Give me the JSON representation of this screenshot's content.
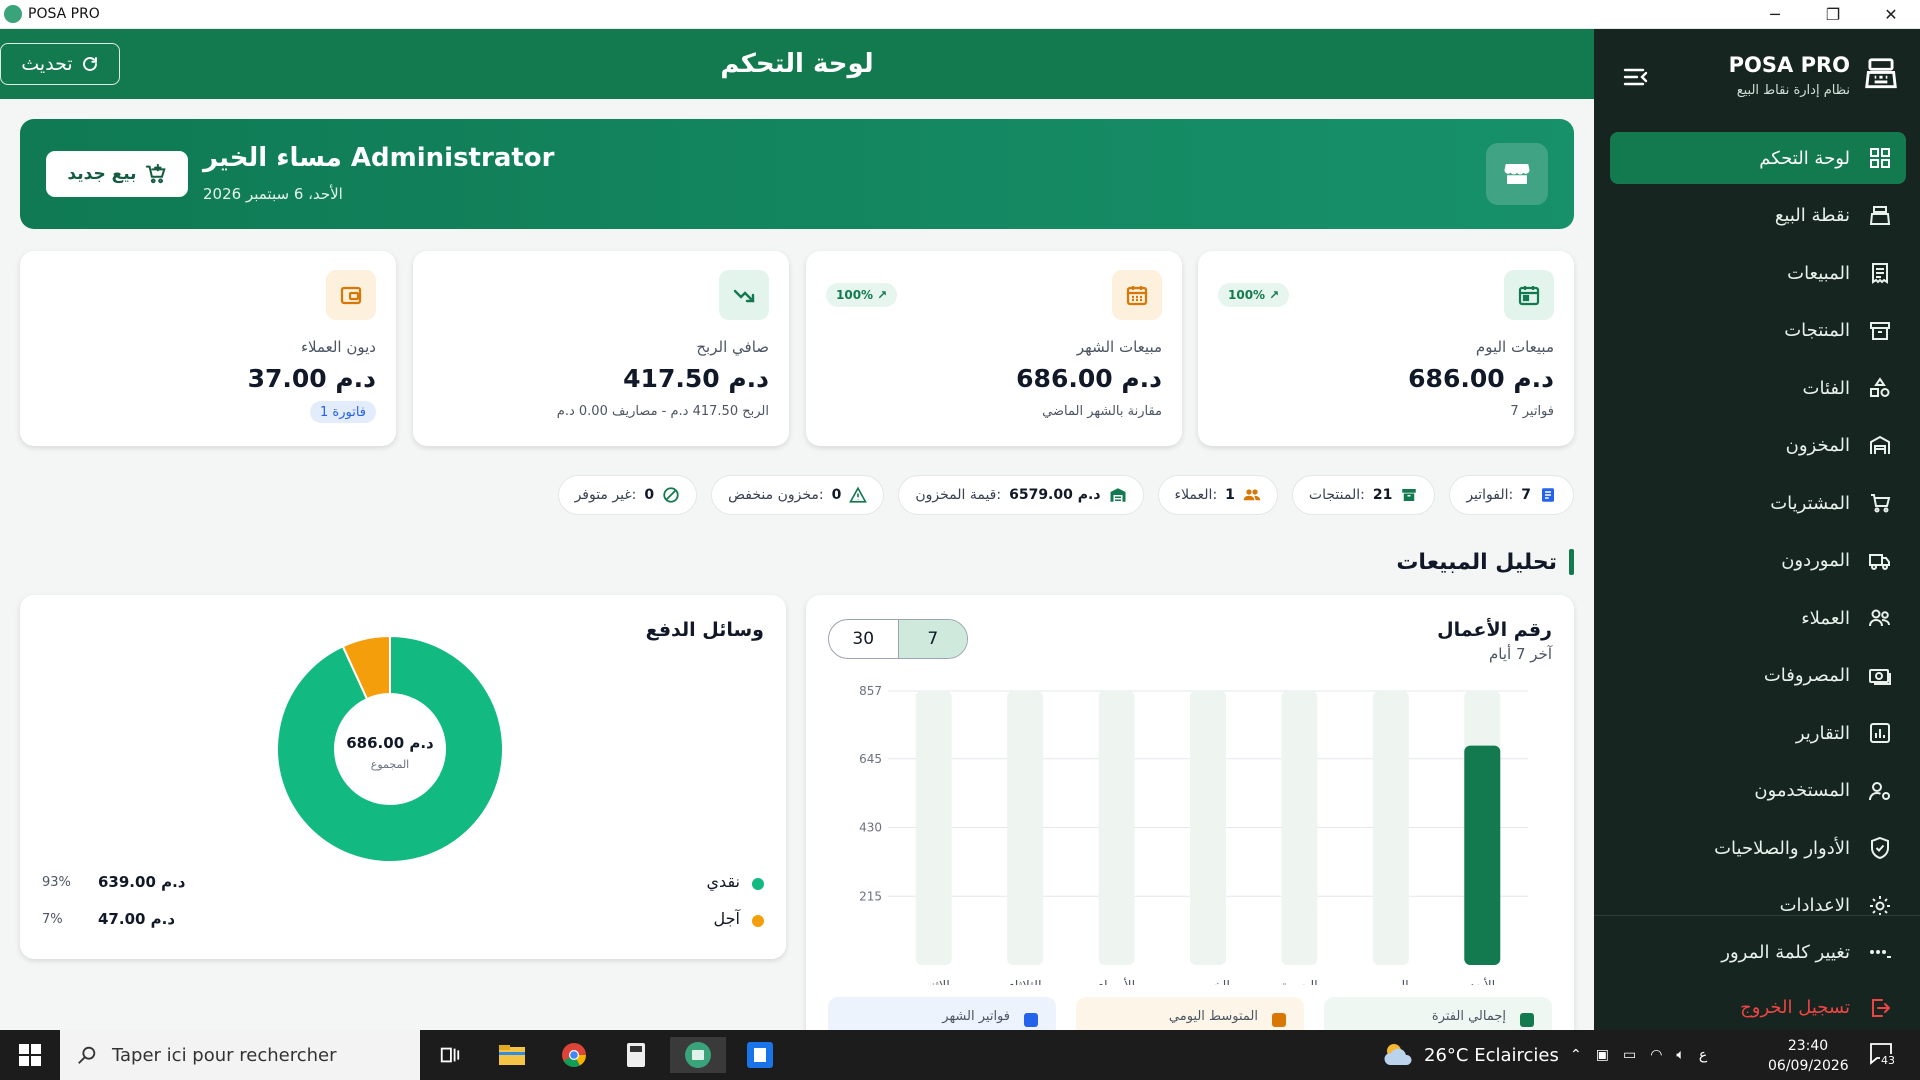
{
  "window": {
    "title": "POSA PRO",
    "controls": [
      "─",
      "❐",
      "✕"
    ]
  },
  "header": {
    "title": "لوحة التحكم",
    "refresh_label": "تحديث"
  },
  "sidebar": {
    "brand": "POSA PRO",
    "tagline": "نظام إدارة نقاط البيع",
    "items": [
      {
        "label": "لوحة التحكم",
        "icon": "dashboard-icon",
        "active": true
      },
      {
        "label": "نقطة البيع",
        "icon": "cash-register-icon"
      },
      {
        "label": "المبيعات",
        "icon": "receipt-icon"
      },
      {
        "label": "المنتجات",
        "icon": "box-icon"
      },
      {
        "label": "الفئات",
        "icon": "shapes-icon"
      },
      {
        "label": "المخزون",
        "icon": "warehouse-icon"
      },
      {
        "label": "المشتريات",
        "icon": "cart-icon"
      },
      {
        "label": "الموردون",
        "icon": "truck-icon"
      },
      {
        "label": "العملاء",
        "icon": "users-icon"
      },
      {
        "label": "المصروفات",
        "icon": "money-icon"
      },
      {
        "label": "التقارير",
        "icon": "chart-icon"
      },
      {
        "label": "المستخدمون",
        "icon": "user-gear-icon"
      },
      {
        "label": "الأدوار والصلاحيات",
        "icon": "shield-icon"
      },
      {
        "label": "الاعدادات",
        "icon": "gear-icon"
      }
    ],
    "bottom": [
      {
        "label": "تغيير كلمة المرور",
        "icon": "password-icon"
      },
      {
        "label": "تسجيل الخروج",
        "icon": "logout-icon"
      }
    ]
  },
  "welcome": {
    "greeting": "مساء الخير Administrator",
    "date": "الأحد، 6 سبتمبر 2026",
    "new_sale_label": "بيع جديد"
  },
  "stats": [
    {
      "label": "مبيعات اليوم",
      "value": "686.00 د.م",
      "sub": "7 فواتير",
      "trend": "100%",
      "icon": "calendar-today-icon",
      "color": "#137a4f",
      "bg": "#e3f4ec"
    },
    {
      "label": "مبيعات الشهر",
      "value": "686.00 د.م",
      "sub": "مقارنة بالشهر الماضي",
      "trend": "100%",
      "icon": "calendar-month-icon",
      "color": "#d97706",
      "bg": "#fdf0dc"
    },
    {
      "label": "صافي الربح",
      "value": "417.50 د.م",
      "sub": "الربح 417.50 د.م - مصاريف 0.00 د.م",
      "icon": "trend-up-icon",
      "color": "#137a4f",
      "bg": "#e3f4ec"
    },
    {
      "label": "ديون العملاء",
      "value": "37.00 د.م",
      "badge": "1 فاتورة",
      "icon": "wallet-icon",
      "color": "#d97706",
      "bg": "#fdf0dc"
    }
  ],
  "chips": [
    {
      "label": "الفواتير:",
      "value": "7",
      "icon": "invoice-icon",
      "color": "#2563eb"
    },
    {
      "label": "المنتجات:",
      "value": "21",
      "icon": "archive-icon",
      "color": "#137a4f"
    },
    {
      "label": "العملاء:",
      "value": "1",
      "icon": "people-icon",
      "color": "#d97706"
    },
    {
      "label": "قيمة المخزون:",
      "value": "6579.00 د.م",
      "icon": "warehouse-icon",
      "color": "#137a4f"
    },
    {
      "label": "مخزون منخفض:",
      "value": "0",
      "icon": "warning-icon",
      "color": "#137a4f"
    },
    {
      "label": "غير متوفر:",
      "value": "0",
      "icon": "ban-icon",
      "color": "#137a4f"
    }
  ],
  "section_title": "تحليل المبيعات",
  "sales_panel": {
    "title": "رقم الأعمال",
    "subtitle": "آخر 7 أيام",
    "toggle": [
      "7",
      "30"
    ],
    "metrics": [
      {
        "label": "إجمالي الفترة",
        "color": "#137a4f",
        "bg": "#eef7f2"
      },
      {
        "label": "المتوسط اليومي",
        "color": "#d97706",
        "bg": "#fdf5e8"
      },
      {
        "label": "فواتير الشهر",
        "color": "#2563eb",
        "bg": "#edf3fc"
      }
    ]
  },
  "chart_data": {
    "type": "bar",
    "title": "رقم الأعمال",
    "subtitle": "آخر 7 أيام",
    "categories": [
      "الأحد",
      "السبت",
      "الجمعة",
      "الخميس",
      "الأربعاء",
      "الثلاثاء",
      "الاثنين"
    ],
    "values": [
      686,
      0,
      0,
      0,
      0,
      0,
      0
    ],
    "yticks": [
      "857",
      "645",
      "430",
      "215"
    ],
    "ylim": [
      0,
      857
    ],
    "grid": true,
    "bar_color": "#137a4f",
    "track_color": "#eef5f1"
  },
  "payment_panel": {
    "title": "وسائل الدفع",
    "center_value": "686.00 د.م",
    "center_label": "المجموع",
    "rows": [
      {
        "name": "نقدي",
        "amount": "639.00 د.م",
        "pct": "93%",
        "value": 639,
        "color": "#12b981"
      },
      {
        "name": "آجل",
        "amount": "47.00 د.م",
        "pct": "7%",
        "value": 47,
        "color": "#f59e0b"
      }
    ]
  },
  "taskbar": {
    "search_placeholder": "Taper ici pour rechercher",
    "weather": "26°C Eclaircies",
    "lang": "ع",
    "time": "23:40",
    "date": "06/09/2026",
    "notifications": "43"
  }
}
